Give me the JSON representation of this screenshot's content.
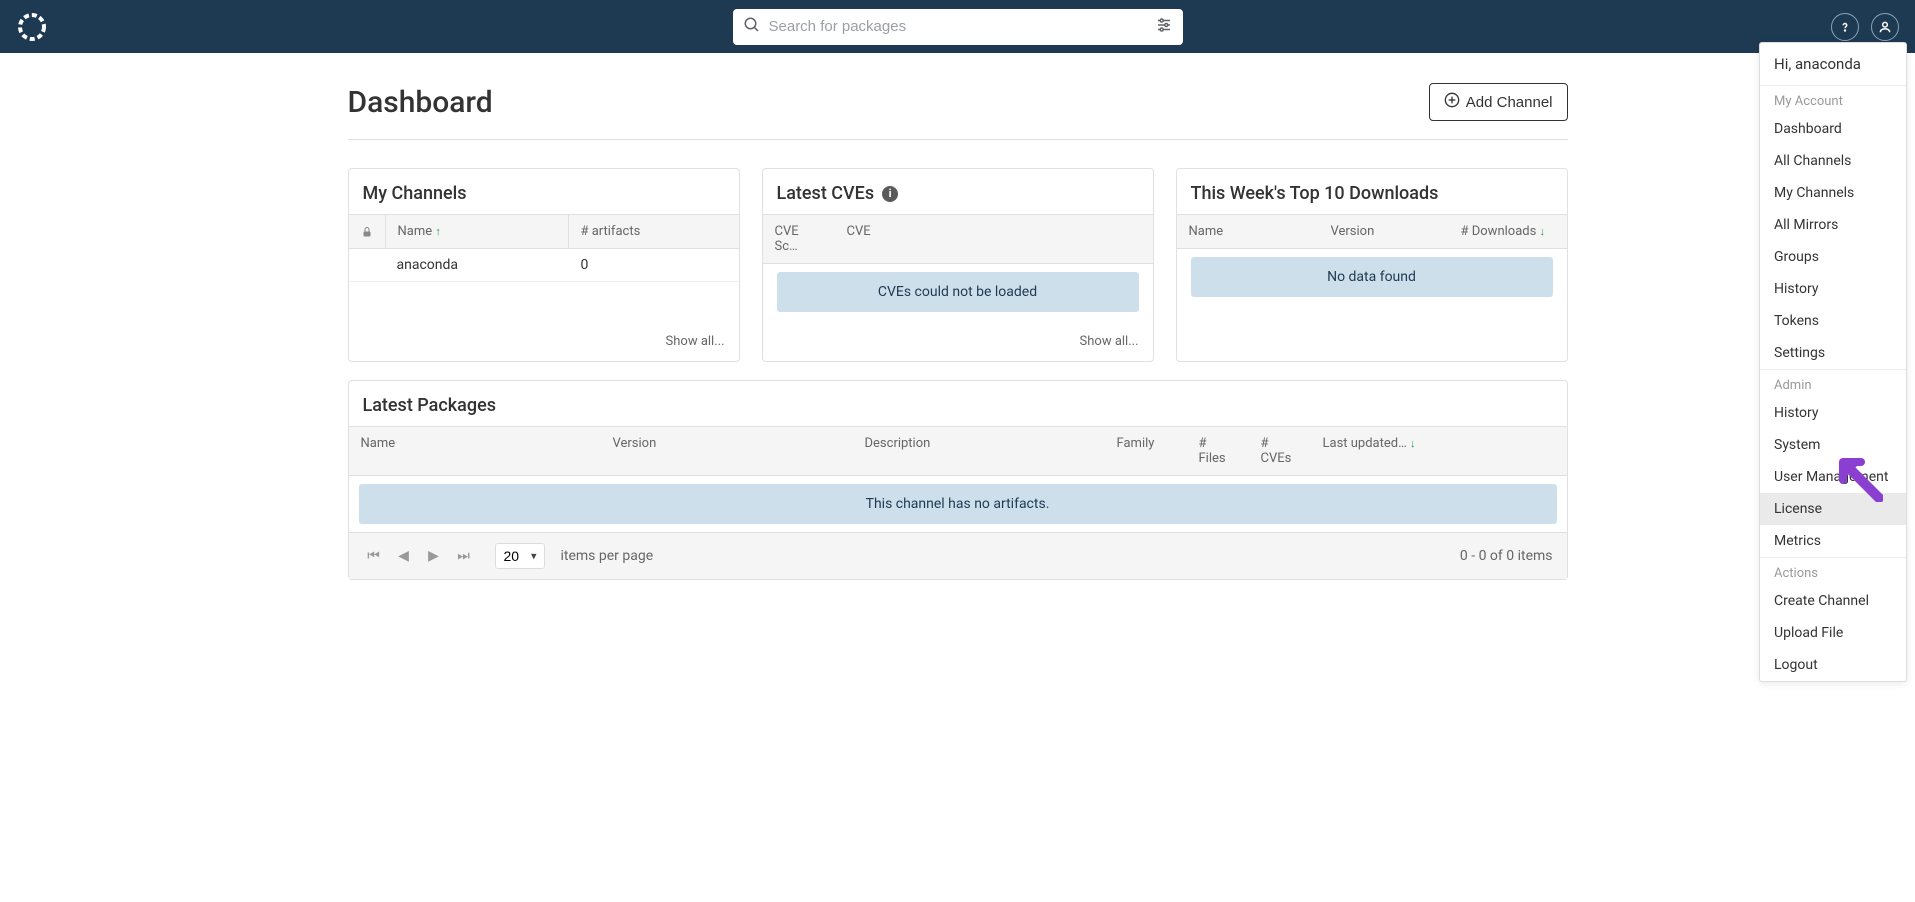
{
  "search": {
    "placeholder": "Search for packages"
  },
  "page": {
    "title": "Dashboard",
    "add_channel": "Add Channel"
  },
  "my_channels": {
    "title": "My Channels",
    "col_name": "Name",
    "col_artifacts": "# artifacts",
    "row": {
      "name": "anaconda",
      "artifacts": "0"
    },
    "show_all": "Show all..."
  },
  "latest_cves": {
    "title": "Latest CVEs",
    "col_score": "CVE Sc…",
    "col_cve": "CVE",
    "alert": "CVEs could not be loaded",
    "show_all": "Show all..."
  },
  "top_downloads": {
    "title": "This Week's Top 10 Downloads",
    "col_name": "Name",
    "col_version": "Version",
    "col_downloads": "# Downloads",
    "alert": "No data found"
  },
  "latest_packages": {
    "title": "Latest Packages",
    "col_name": "Name",
    "col_version": "Version",
    "col_desc": "Description",
    "col_family": "Family",
    "col_files": "# Files",
    "col_cves": "# CVEs",
    "col_updated": "Last updated…",
    "alert": "This channel has no artifacts."
  },
  "pagination": {
    "page_size": "20",
    "items_per_page": "items per page",
    "info": "0 - 0 of 0 items"
  },
  "dropdown": {
    "greeting": "Hi, anaconda",
    "section_account": "My Account",
    "account_items": [
      "Dashboard",
      "All Channels",
      "My Channels",
      "All Mirrors",
      "Groups",
      "History",
      "Tokens",
      "Settings"
    ],
    "section_admin": "Admin",
    "admin_items": [
      "History",
      "System",
      "User Management",
      "License",
      "Metrics"
    ],
    "section_actions": "Actions",
    "action_items": [
      "Create Channel",
      "Upload File",
      "Logout"
    ]
  }
}
